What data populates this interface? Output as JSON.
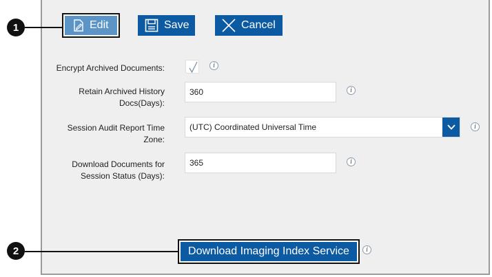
{
  "toolbar": {
    "edit_label": "Edit",
    "save_label": "Save",
    "cancel_label": "Cancel"
  },
  "form": {
    "encrypt": {
      "label": "Encrypt Archived Documents:",
      "checked": true
    },
    "retain": {
      "label_line1": "Retain Archived History",
      "label_line2": "Docs(Days):",
      "value": "360"
    },
    "timezone": {
      "label_line1": "Session Audit Report Time",
      "label_line2": "Zone:",
      "value": "(UTC) Coordinated Universal Time"
    },
    "download_docs": {
      "label_line1": "Download Documents for",
      "label_line2": "Session Status (Days):",
      "value": "365"
    }
  },
  "download_service": {
    "label": "Download Imaging Index Service"
  },
  "callouts": {
    "one": "1",
    "two": "2"
  },
  "info_glyph": "i",
  "colors": {
    "primary": "#0b5aa2",
    "edit_active": "#5b95c8",
    "panel_bg": "#efefef"
  }
}
